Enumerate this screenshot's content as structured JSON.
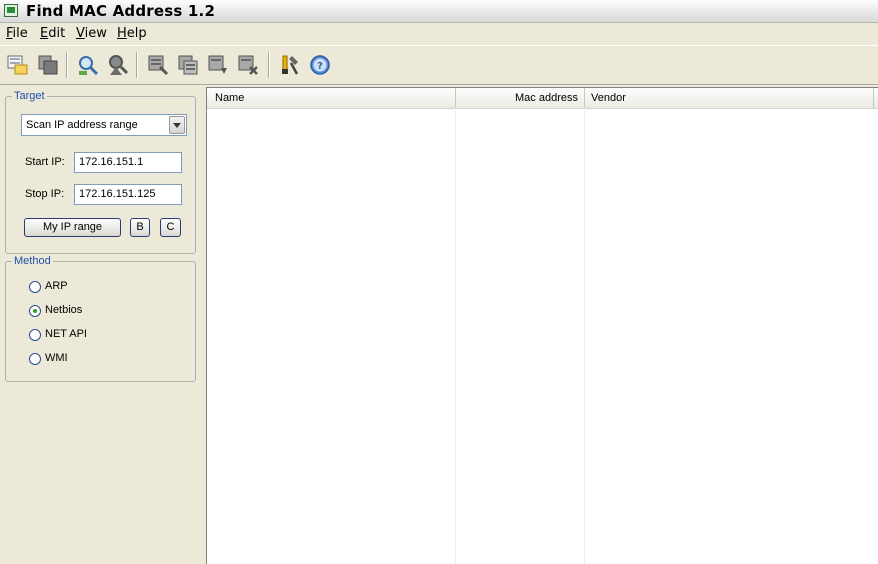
{
  "window": {
    "title": "Find MAC Address 1.2"
  },
  "menu": [
    {
      "key": "F",
      "rest": "ile"
    },
    {
      "key": "E",
      "rest": "dit"
    },
    {
      "key": "V",
      "rest": "iew"
    },
    {
      "key": "H",
      "rest": "elp"
    }
  ],
  "toolbar": {
    "icons": [
      "new-scan-icon",
      "copy-icon",
      "find-icon",
      "find-next-icon",
      "select-icon",
      "select-all-icon",
      "export-icon",
      "delete-icon",
      "tools-icon",
      "help-icon"
    ]
  },
  "target": {
    "group_label": "Target",
    "mode": "Scan IP address range",
    "start_label": "Start IP:",
    "start_value": "172.16.151.1",
    "stop_label": "Stop IP:",
    "stop_value": "172.16.151.125",
    "my_ip_button": "My IP range",
    "b_button": "B",
    "c_button": "C"
  },
  "method": {
    "group_label": "Method",
    "options": [
      "ARP",
      "Netbios",
      "NET API",
      "WMI"
    ],
    "selected": "Netbios"
  },
  "results": {
    "columns": [
      "Name",
      "Mac address",
      "Vendor"
    ]
  },
  "colors": {
    "group_label": "#1f4fa8",
    "radio_dot": "#27a327"
  }
}
